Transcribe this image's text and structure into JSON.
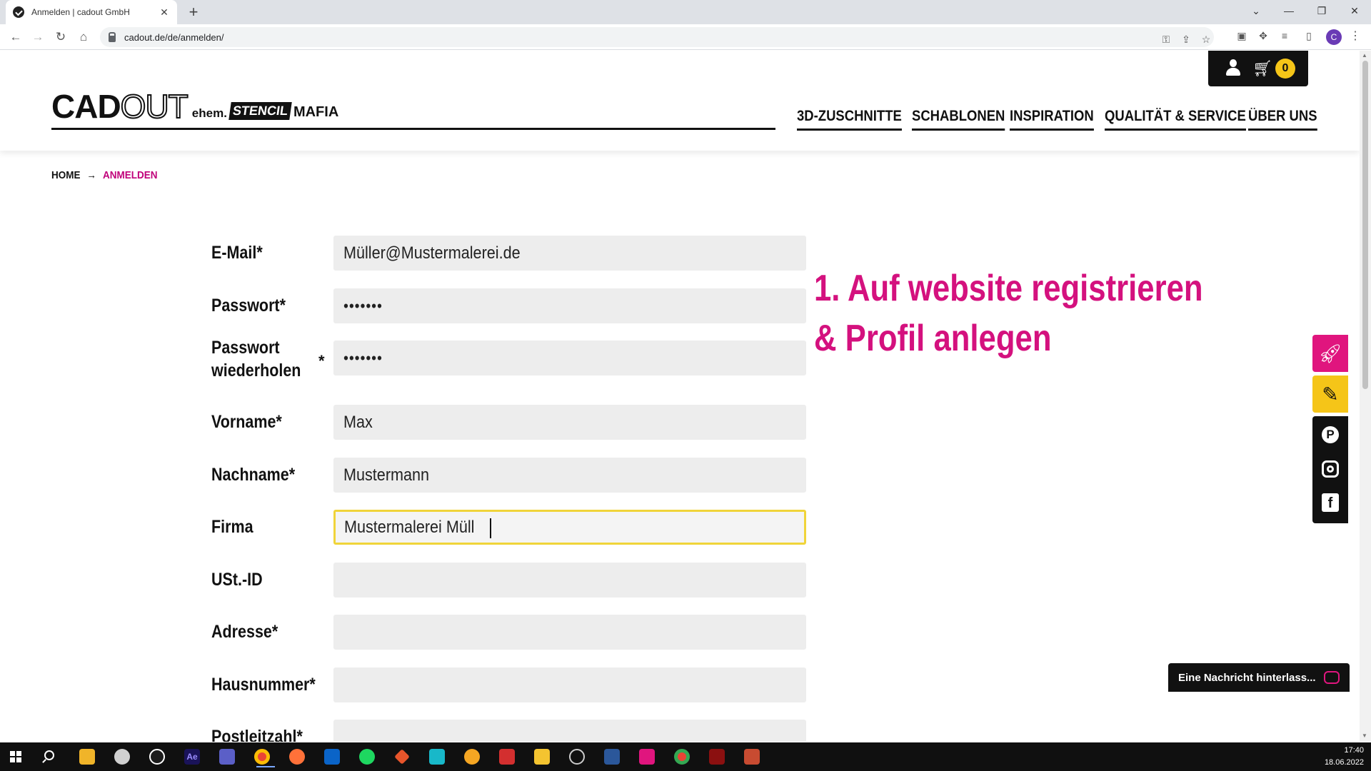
{
  "browser": {
    "tab_title": "Anmelden | cadout GmbH",
    "url": "cadout.de/de/anmelden/",
    "profile_initial": "C"
  },
  "header": {
    "logo": {
      "brand_part1": "CAD",
      "brand_part2": "OUT",
      "ehem": "ehem.",
      "stencil": "STENCIL",
      "mafia": "MAFIA"
    },
    "nav": [
      "3D-ZUSCHNITTE",
      "SCHABLONEN",
      "INSPIRATION",
      "QUALITÄT & SERVICE",
      "ÜBER UNS"
    ],
    "cart_count": "0"
  },
  "breadcrumb": {
    "home": "HOME",
    "current": "ANMELDEN"
  },
  "form": {
    "email": {
      "label": "E-Mail*",
      "value": "Müller@Mustermalerei.de"
    },
    "password": {
      "label": "Passwort*",
      "value": "•••••••"
    },
    "password_repeat": {
      "label_line1": "Passwort",
      "label_line2": "wiederholen",
      "star": "*",
      "value": "•••••••"
    },
    "firstname": {
      "label": "Vorname*",
      "value": "Max"
    },
    "lastname": {
      "label": "Nachname*",
      "value": "Mustermann"
    },
    "company": {
      "label": "Firma",
      "value": "Mustermalerei Müll"
    },
    "vat": {
      "label": "USt.-ID",
      "value": ""
    },
    "address": {
      "label": "Adresse*",
      "value": ""
    },
    "house_number": {
      "label": "Hausnummer*",
      "value": ""
    },
    "postcode": {
      "label": "Postleitzahl*",
      "value": ""
    }
  },
  "promo": {
    "line1": "1. Auf website registrieren",
    "line2": "& Profil anlegen"
  },
  "chat": {
    "label": "Eine Nachricht hinterlass..."
  },
  "taskbar": {
    "time": "17:40",
    "date": "18.06.2022"
  },
  "colors": {
    "accent_pink": "#d4117e",
    "accent_yellow": "#f5c518",
    "focus_border": "#f0d43a"
  }
}
